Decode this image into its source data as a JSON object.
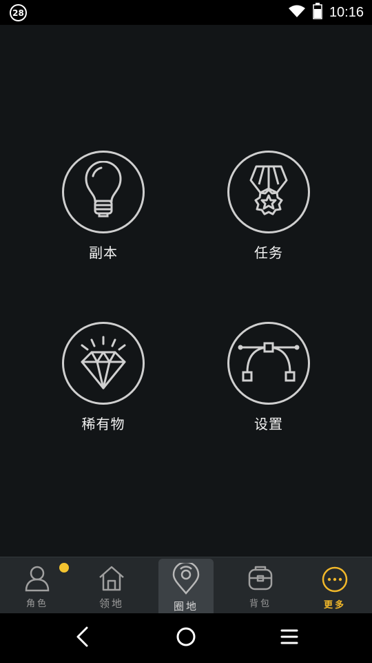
{
  "status_bar": {
    "notification_count": "28",
    "time": "10:16",
    "icons": [
      "wifi-icon",
      "battery-icon"
    ]
  },
  "menu": {
    "items": [
      {
        "label": "副本",
        "icon": "lightbulb-icon"
      },
      {
        "label": "任务",
        "icon": "medal-icon"
      },
      {
        "label": "稀有物",
        "icon": "diamond-icon"
      },
      {
        "label": "设置",
        "icon": "bezier-curve-icon"
      }
    ]
  },
  "tab_bar": {
    "tabs": [
      {
        "label": "角色",
        "icon": "person-icon",
        "has_badge": true
      },
      {
        "label": "领地",
        "icon": "house-icon"
      },
      {
        "label": "圈地",
        "icon": "map-pin-icon",
        "active": true
      },
      {
        "label": "背包",
        "icon": "backpack-icon"
      },
      {
        "label": "更多",
        "icon": "more-dots-icon",
        "accent": "#f2b82a"
      }
    ]
  },
  "nav_bar": {
    "buttons": [
      "back-icon",
      "home-icon",
      "menu-icon"
    ]
  },
  "colors": {
    "background": "#121517",
    "tab_bar": "#25292c",
    "accent": "#f2b82a",
    "badge": "#f4c430"
  }
}
